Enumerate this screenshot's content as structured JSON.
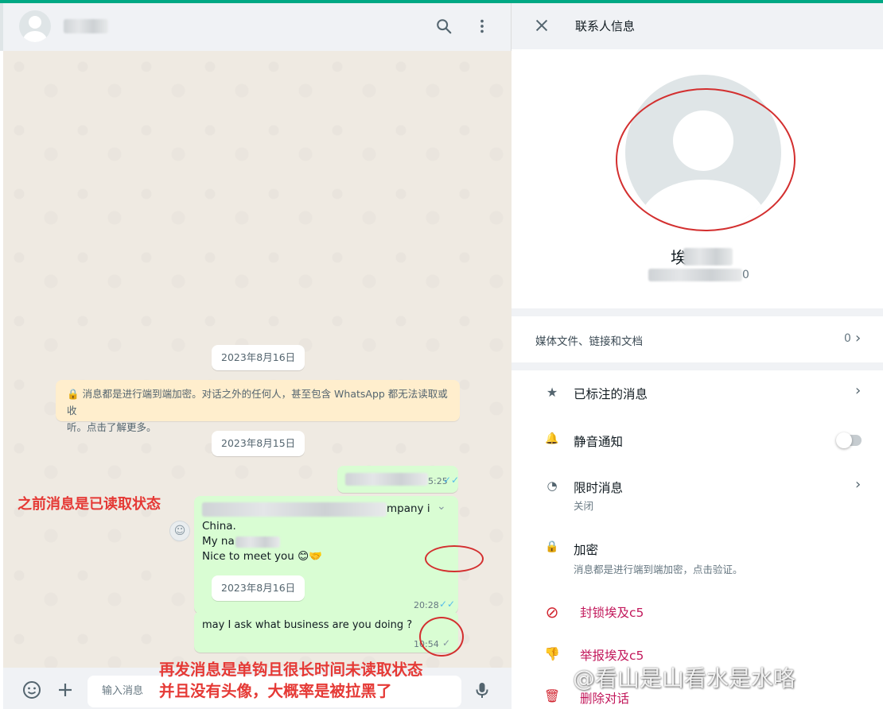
{
  "chat": {
    "header": {
      "contact_name": "",
      "icons": [
        "search-icon",
        "menu-icon"
      ]
    },
    "dates": [
      "2023年8月16日",
      "2023年8月15日",
      "2023年8月16日"
    ],
    "encryption_notice": {
      "line1": "消息都是进行端到端加密。对话之外的任何人，甚至包含 WhatsApp 都无法读取或收",
      "line2": "听。点击了解更多。"
    },
    "messages": [
      {
        "text_visible": "",
        "time": "5:25",
        "status": "read"
      },
      {
        "partial_tail": "mpany i",
        "line_china": "China.",
        "line_name": "My na",
        "line_meet": "Nice to meet you 😊🤝",
        "time": "20:28",
        "status": "read"
      },
      {
        "text": "may I  ask what business are you doing ?",
        "time": "10:54",
        "status": "sent"
      }
    ],
    "footer": {
      "placeholder": "输入消息",
      "icons": [
        "emoji-icon",
        "plus-icon",
        "mic-icon"
      ]
    }
  },
  "annotations": {
    "read_note": "之前消息是已读取状态",
    "blocked_note_line1": "再发消息是单钩且很长时间未读取状态",
    "blocked_note_line2": "并且没有头像，大概率是被拉黑了"
  },
  "info": {
    "title": "联系人信息",
    "name_partial": "埃",
    "phone_tail": "0",
    "media": {
      "label": "媒体文件、链接和文档",
      "count": "0"
    },
    "starred": "已标注的消息",
    "mute": "静音通知",
    "disappearing": {
      "label": "限时消息",
      "sub": "关闭"
    },
    "encryption": {
      "label": "加密",
      "sub": "消息都是进行端到端加密，点击验证。"
    },
    "block": "封锁埃及c5",
    "report": "举报埃及c5",
    "delete": "删除对话"
  },
  "watermark": "@看山是山看水是水咯",
  "colors": {
    "accent": "#00a884",
    "bubble_out": "#d9fdd3",
    "read_tick": "#53bdeb",
    "annotation_red": "#e53935"
  }
}
